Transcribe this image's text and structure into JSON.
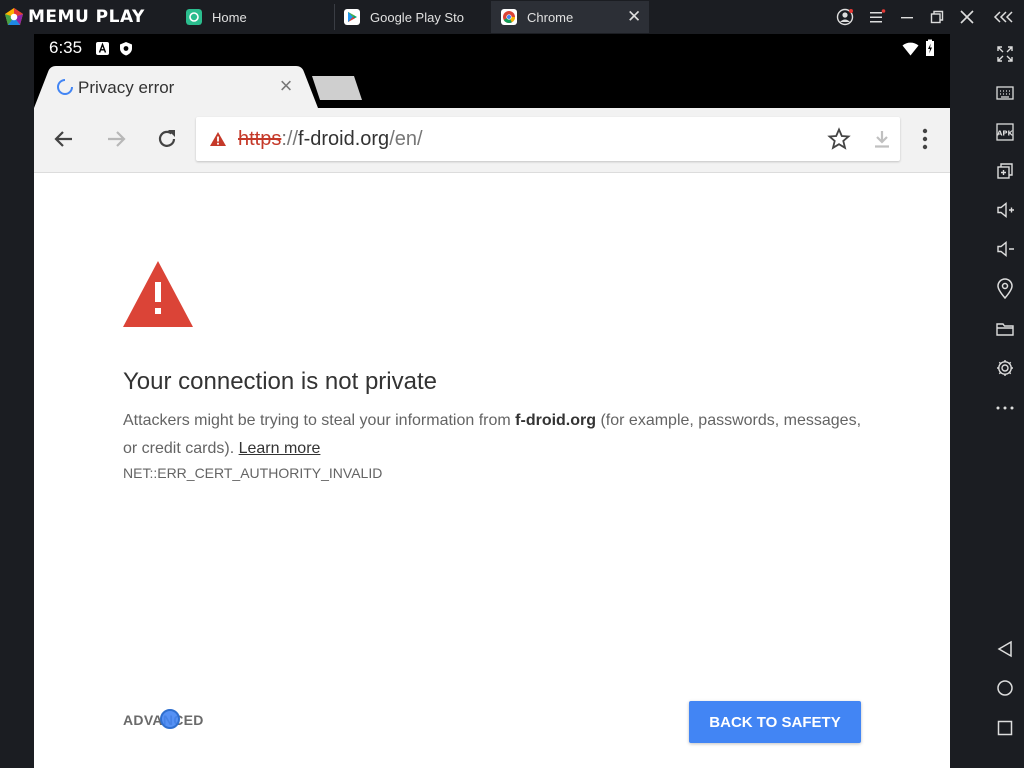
{
  "emulator": {
    "brand": "MEMU PLAY",
    "tabs": [
      {
        "label": "Home",
        "active": false
      },
      {
        "label": "Google Play Store",
        "active": false
      },
      {
        "label": "Chrome",
        "active": true
      }
    ]
  },
  "status_bar": {
    "time": "6:35"
  },
  "chrome": {
    "tab_title": "Privacy error",
    "url": {
      "scheme": "https",
      "separator": "://",
      "host": "f-droid.org",
      "path": "/en/"
    }
  },
  "error_page": {
    "title": "Your connection is not private",
    "body_before": "Attackers might be trying to steal your information from ",
    "body_host": "f-droid.org",
    "body_after": " (for example, passwords, messages, or credit cards). ",
    "learn_more": "Learn more",
    "error_code": "NET::ERR_CERT_AUTHORITY_INVALID",
    "advanced_label": "ADVANCED",
    "safety_label": "BACK TO SAFETY"
  },
  "colors": {
    "accent": "#4285f4",
    "warning_red": "#db4437"
  },
  "icons": {
    "sidebar": [
      "fullscreen-icon",
      "keyboard-icon",
      "apk-icon",
      "add-window-icon",
      "volume-up-icon",
      "volume-down-icon",
      "location-icon",
      "folder-icon",
      "settings-icon",
      "more-icon",
      "android-back-icon",
      "android-home-icon",
      "android-recents-icon"
    ]
  }
}
